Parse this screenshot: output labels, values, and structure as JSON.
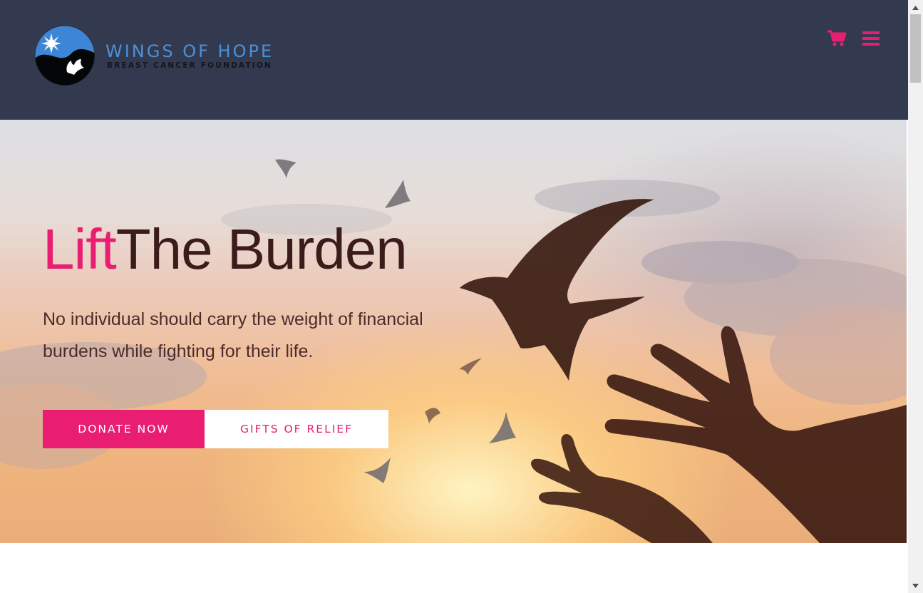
{
  "header": {
    "logo": {
      "title": "WINGS OF HOPE",
      "subtitle": "BREAST CANCER FOUNDATION"
    },
    "icons": [
      "shopping-cart-icon",
      "menu-icon"
    ]
  },
  "hero": {
    "title_accent": "Lift",
    "title_rest": "The Burden",
    "description": "No individual should carry the weight of financial burdens while fighting for their life.",
    "buttons": {
      "donate_label": "Donate Now",
      "gifts_label": "Gifts of Relief"
    }
  },
  "colors": {
    "header_bg": "#333a4f",
    "accent": "#e91e72",
    "logo_blue": "#4a90d9",
    "hero_text": "#3b1c1a"
  }
}
